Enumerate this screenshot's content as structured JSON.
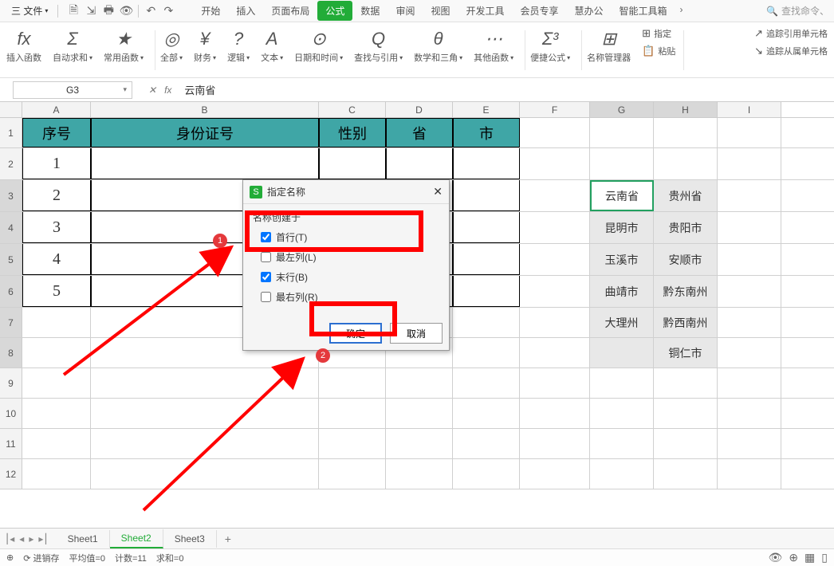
{
  "menubar": {
    "file_label": "三 文件",
    "quick_icons": [
      "save",
      "export",
      "print",
      "preview",
      "undo",
      "redo"
    ]
  },
  "tabs": [
    "开始",
    "插入",
    "页面布局",
    "公式",
    "数据",
    "审阅",
    "视图",
    "开发工具",
    "会员专享",
    "慧办公",
    "智能工具箱"
  ],
  "active_tab": "公式",
  "search_placeholder": "查找命令、",
  "ribbon": {
    "groups": [
      {
        "icon": "fx",
        "label": "插入函数"
      },
      {
        "icon": "Σ",
        "label": "自动求和"
      },
      {
        "icon": "★",
        "label": "常用函数"
      },
      {
        "icon": "◎",
        "label": "全部"
      },
      {
        "icon": "¥",
        "label": "财务"
      },
      {
        "icon": "?",
        "label": "逻辑"
      },
      {
        "icon": "A",
        "label": "文本"
      },
      {
        "icon": "⊙",
        "label": "日期和时间"
      },
      {
        "icon": "Q",
        "label": "查找与引用"
      },
      {
        "icon": "θ",
        "label": "数学和三角"
      },
      {
        "icon": "⋯",
        "label": "其他函数"
      },
      {
        "icon": "Σ³",
        "label": "便捷公式"
      },
      {
        "icon": "⊞",
        "label": "名称管理器"
      }
    ],
    "right_col1": [
      {
        "icon": "⊞",
        "label": "指定"
      },
      {
        "icon": "📋",
        "label": "粘贴"
      }
    ],
    "right_col2": [
      {
        "icon": "↗",
        "label": "追踪引用单元格"
      },
      {
        "icon": "↘",
        "label": "追踪从属单元格"
      }
    ]
  },
  "formula_bar": {
    "namebox": "G3",
    "value": "云南省"
  },
  "columns": [
    "A",
    "B",
    "C",
    "D",
    "E",
    "F",
    "G",
    "H",
    "I"
  ],
  "header_row": {
    "A": "序号",
    "B": "身份证号",
    "C": "性别",
    "D": "省",
    "E": "市"
  },
  "data_rows": [
    "1",
    "2",
    "3",
    "4",
    "5"
  ],
  "gh_table": {
    "G": [
      "云南省",
      "昆明市",
      "玉溪市",
      "曲靖市",
      "大理州",
      ""
    ],
    "H": [
      "贵州省",
      "贵阳市",
      "安顺市",
      "黔东南州",
      "黔西南州",
      "铜仁市"
    ]
  },
  "dialog": {
    "title": "指定名称",
    "group_label": "名称创建于",
    "options": [
      {
        "label": "首行(T)",
        "checked": true
      },
      {
        "label": "最左列(L)",
        "checked": false
      },
      {
        "label": "末行(B)",
        "checked": true
      },
      {
        "label": "最右列(R)",
        "checked": false
      }
    ],
    "ok_label": "确定",
    "cancel_label": "取消"
  },
  "markers": {
    "m1": "1",
    "m2": "2"
  },
  "sheet_tabs": [
    "Sheet1",
    "Sheet2",
    "Sheet3"
  ],
  "active_sheet": "Sheet2",
  "status": {
    "mode_icon": "⊕",
    "undo_label": "进销存",
    "avg": "平均值=0",
    "count": "计数=11",
    "sum": "求和=0"
  }
}
